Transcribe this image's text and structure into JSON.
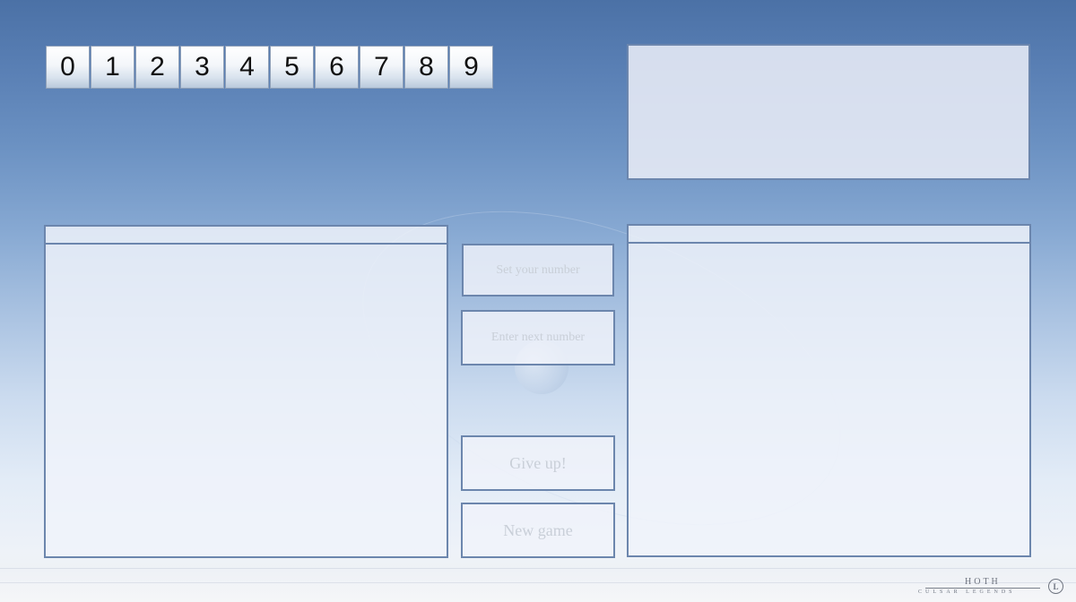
{
  "digits": [
    "0",
    "1",
    "2",
    "3",
    "4",
    "5",
    "6",
    "7",
    "8",
    "9"
  ],
  "controls": {
    "set_number_placeholder": "Set your number",
    "next_number_placeholder": "Enter next number",
    "give_up_label": "Give up!",
    "new_game_label": "New game"
  },
  "watermark": {
    "title": "HOTH",
    "subtitle": "CULSAR LEGENDS",
    "badge": "L"
  },
  "colors": {
    "panel_border": "#6c86ad",
    "sky_top": "#4b71a6",
    "ground": "#f4f6f9",
    "placeholder_text": "#c9cfd8"
  }
}
